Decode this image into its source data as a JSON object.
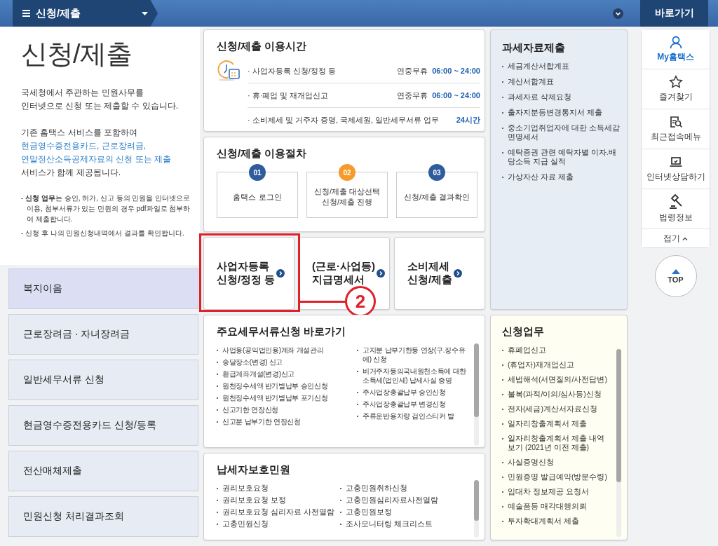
{
  "top_bar": {
    "menu_title": "신청/제출",
    "shortcut_label": "바로가기"
  },
  "intro": {
    "title": "신청/제출",
    "paragraphs": [
      [
        {
          "text": "국세청에서 주관하는 민원사무를",
          "highlight": false
        },
        {
          "text": "인터넷으로 신청 또는 제출할 수 있습니다.",
          "highlight": false
        }
      ],
      [
        {
          "text": "기존 홈택스 서비스를 포함하여",
          "highlight": false
        },
        {
          "text": "현금영수증전용카드, 근로장려금, 연말정산소득공제자료의 신청 또는 제출",
          "highlight": true
        },
        {
          "text": "서비스가 함께 제공됩니다.",
          "highlight": false
        }
      ]
    ],
    "notes": [
      "- **신청 업무**는 승인, 허가, 신고 등의 민원을 인터넷으로 이용, 첨부서류가 있는 민원의 경우 pdf파일로 첨부하여 제출합니다.",
      "- 신청 후 나의 민원신청내역에서 결과를 확인합니다."
    ]
  },
  "left_menu": [
    {
      "label": "복지이음",
      "selected": true
    },
    {
      "label": "근로장려금 · 자녀장려금",
      "selected": false
    },
    {
      "label": "일반세무서류 신청",
      "selected": false
    },
    {
      "label": "현금영수증전용카드 신청/등록",
      "selected": false
    },
    {
      "label": "전산매체제출",
      "selected": false
    },
    {
      "label": "민원신청 처리결과조회",
      "selected": false
    }
  ],
  "hours": {
    "title": "신청/제출 이용시간",
    "rows": [
      {
        "label": "· 사업자등록 신청/정정 등",
        "prefix": "연중무휴",
        "time": "06:00 ~ 24:00"
      },
      {
        "label": "· 휴·폐업 및 재개업신고",
        "prefix": "연중무휴",
        "time": "06:00 ~ 24:00"
      },
      {
        "label": "· 소비제세 및 거주자 증명, 국제세원, 일반세무서류 업무",
        "time": "24시간"
      }
    ]
  },
  "procedure": {
    "title": "신청/제출 이용절차",
    "steps": [
      {
        "number": "01",
        "lines": [
          "홈택스 로그인"
        ],
        "color": "#2f5c9c"
      },
      {
        "number": "02",
        "lines": [
          "신청/제출 대상선택",
          "신청/제출 진행"
        ],
        "color": "#f59b2b"
      },
      {
        "number": "03",
        "lines": [
          "신청/제출 결과확인"
        ],
        "color": "#2f5c9c"
      }
    ]
  },
  "tiles": [
    {
      "lines": [
        "사업자등록",
        "신청/정정 등"
      ]
    },
    {
      "lines": [
        "(근로·사업등)",
        "지급명세서"
      ]
    },
    {
      "lines": [
        "소비제세",
        "신청/제출"
      ]
    }
  ],
  "annotation": {
    "label": "2"
  },
  "major_documents": {
    "title": "주요세무서류신청 바로가기",
    "columns": [
      [
        "사업용(공익법인용)계좌 개설관리",
        "송달장소(변경) 신고",
        "환급계좌개설(변경)신고",
        "원천징수세액 반기별납부 승인신청",
        "원천징수세액 반기별납부 포기신청",
        "신고기한 연장신청",
        "신고분 납부기한 연장신청"
      ],
      [
        "고지분 납부기한등 연장(구.징수유예) 신청",
        "비거주자등의국내원천소득에 대한 소득세(법인세) 납세사실 증명",
        "주사업장총괄납부 승인신청",
        "주사업장총괄납부 변경신청",
        "주류운반용차량 검인스티커 발"
      ]
    ]
  },
  "taxpayer_protection": {
    "title": "납세자보호민원",
    "columns": [
      [
        "권리보호요청",
        "권리보호요청 보정",
        "권리보호요청 심리자료 사전열람",
        "고충민원신청"
      ],
      [
        "고충민원취하신청",
        "고충민원심리자료사전열람",
        "고충민원보정",
        "조사모니터링 체크리스트"
      ]
    ]
  },
  "tax_data": {
    "title": "과세자료제출",
    "items": [
      "세금계산서합계표",
      "계산서합계표",
      "과세자료 삭제요청",
      "출자지분등변경통지서 제출",
      "중소기업취업자에 대한 소득세감면명세서",
      "예탁증권 관련 예탁자별 이자.배당소득 지급 실적",
      "가상자산 자료 제출"
    ]
  },
  "applications": {
    "title": "신청업무",
    "items": [
      "휴폐업신고",
      "(휴업자)재개업신고",
      "세법해석(서면질의/사전답변)",
      "불복(과적/이의/심사등)신청",
      "전자(세금)계산서자료신청",
      "일자리창출계획서 제출",
      "일자리창출계획서 제출 내역보기 (2021년 이전 제출)",
      "사실증명신청",
      "민원증명 발급예약(방문수령)",
      "임대차 정보제공 요청서",
      "예술품등 매각대행의뢰",
      "투자확대계획서 제출"
    ]
  },
  "quick_menu": {
    "items": [
      {
        "kind": "person",
        "label": "My홈택스",
        "selected": true
      },
      {
        "kind": "star",
        "label": "즐겨찾기",
        "selected": false
      },
      {
        "kind": "recent",
        "label": "최근접속메뉴",
        "selected": false
      },
      {
        "kind": "laptop",
        "label": "인터넷상담하기",
        "selected": false
      },
      {
        "kind": "gavel",
        "label": "법령정보",
        "selected": false
      }
    ],
    "collapse_label": "접기",
    "top_label": "TOP"
  }
}
